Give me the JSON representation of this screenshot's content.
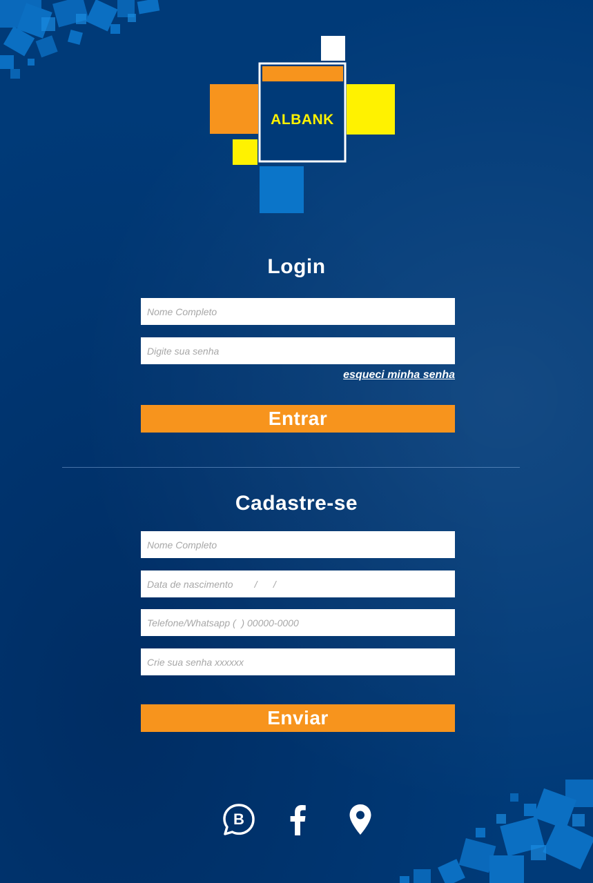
{
  "brand": {
    "logo_text": "ALBANK"
  },
  "colors": {
    "background": "#003a78",
    "accent": "#f7941d",
    "logo_yellow": "#fff200",
    "logo_light_blue": "#0b75c9"
  },
  "login": {
    "title": "Login",
    "name_placeholder": "Nome Completo",
    "password_placeholder": "Digite sua senha",
    "forgot_label": "esqueci minha senha",
    "submit_label": "Entrar"
  },
  "signup": {
    "title": "Cadastre-se",
    "name_placeholder": "Nome Completo",
    "birth_placeholder": "Data de nascimento        /      /",
    "phone_placeholder": "Telefone/Whatsapp (  ) 00000-0000",
    "password_placeholder": "Crie sua senha xxxxxx",
    "submit_label": "Enviar"
  },
  "social": [
    {
      "icon": "whatsapp-business-icon"
    },
    {
      "icon": "facebook-icon"
    },
    {
      "icon": "location-pin-icon"
    }
  ]
}
